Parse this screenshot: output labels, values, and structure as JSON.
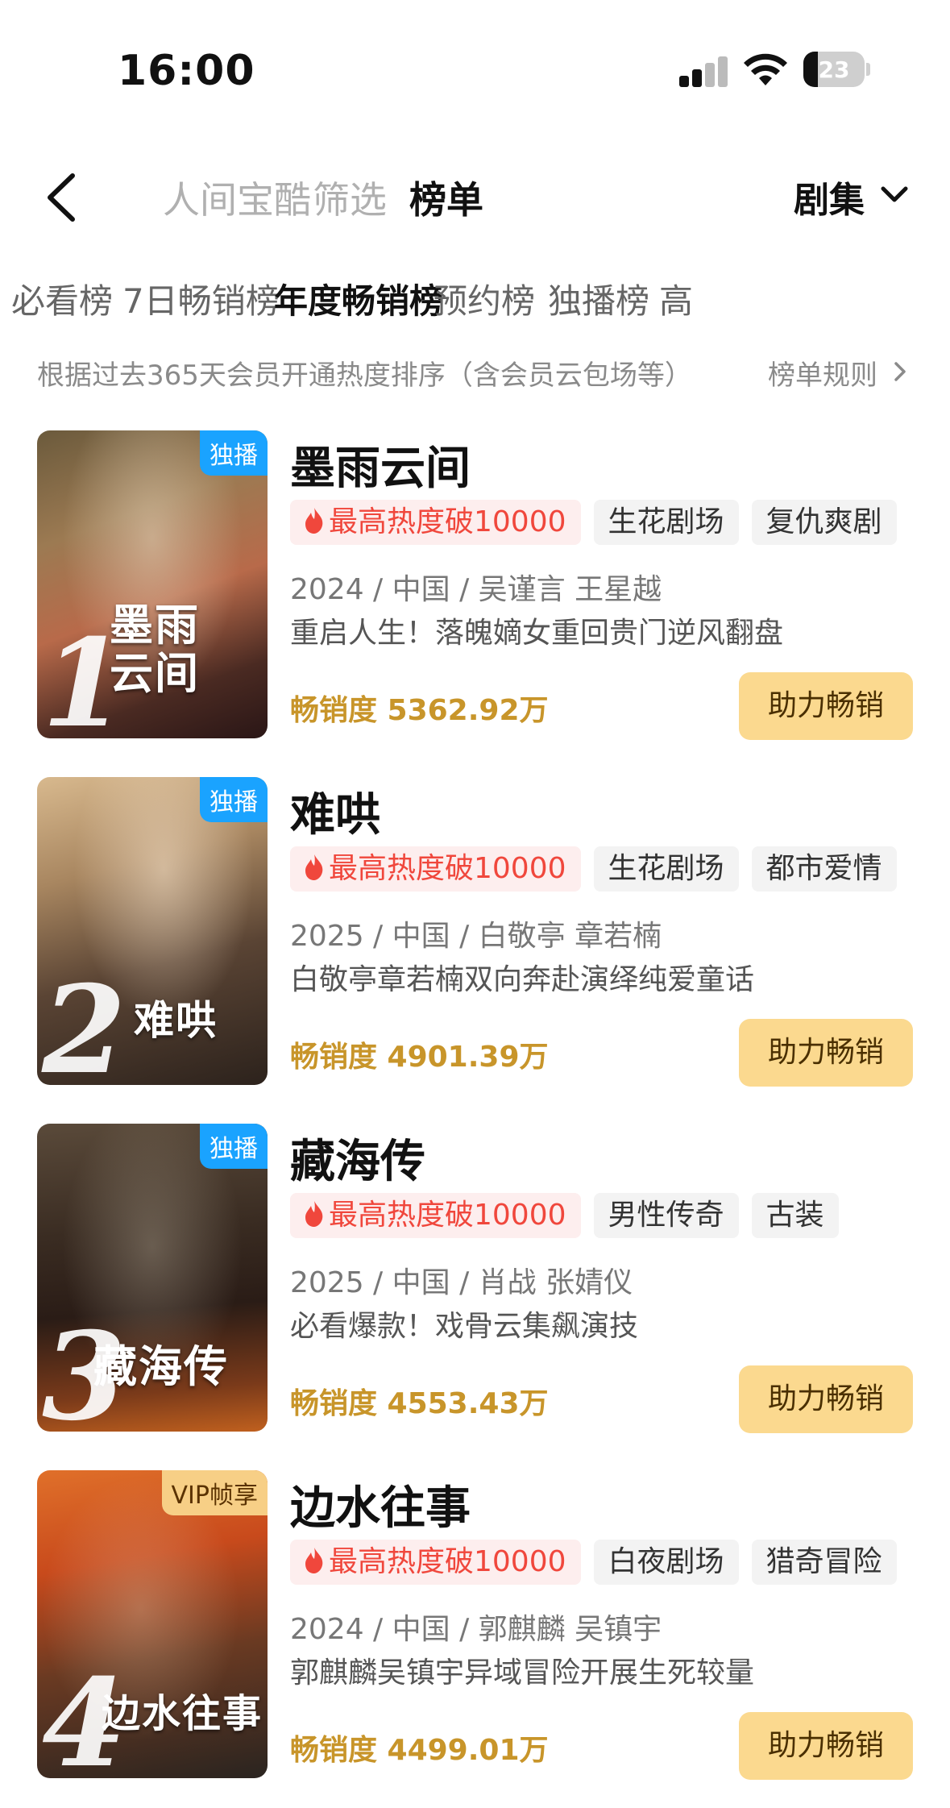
{
  "status_bar": {
    "time": "16:00",
    "battery": "23"
  },
  "nav": {
    "tabs": [
      {
        "label": "人间宝酷",
        "active": false
      },
      {
        "label": "筛选",
        "active": false
      },
      {
        "label": "榜单",
        "active": true
      }
    ],
    "category": "剧集"
  },
  "rank_tabs": [
    {
      "label": "必看榜",
      "active": false
    },
    {
      "label": "7日畅销榜",
      "active": false
    },
    {
      "label": "年度畅销榜",
      "active": true
    },
    {
      "label": "预约榜",
      "active": false
    },
    {
      "label": "独播榜",
      "active": false
    },
    {
      "label": "高",
      "active": false
    }
  ],
  "description": "根据过去365天会员开通热度排序（含会员云包场等）",
  "rules_label": "榜单规则",
  "boost_label": "助力畅销",
  "items": [
    {
      "rank": "1",
      "badge": "独播",
      "badge_type": "exclusive",
      "title": "墨雨云间",
      "poster_title": "墨雨 云间",
      "hot": "最高热度破10000",
      "tags": [
        "生花剧场",
        "复仇爽剧"
      ],
      "meta": "2024 / 中国 / 吴谨言 王星越",
      "tagline": "重启人生！落魄嫡女重回贵门逆风翻盘",
      "sales": "畅销度 5362.92万"
    },
    {
      "rank": "2",
      "badge": "独播",
      "badge_type": "exclusive",
      "title": "难哄",
      "poster_title": "难哄",
      "hot": "最高热度破10000",
      "tags": [
        "生花剧场",
        "都市爱情"
      ],
      "meta": "2025 / 中国 / 白敬亭 章若楠",
      "tagline": "白敬亭章若楠双向奔赴演绎纯爱童话",
      "sales": "畅销度 4901.39万"
    },
    {
      "rank": "3",
      "badge": "独播",
      "badge_type": "exclusive",
      "title": "藏海传",
      "poster_title": "藏海传",
      "hot": "最高热度破10000",
      "tags": [
        "男性传奇",
        "古装"
      ],
      "meta": "2025 / 中国 / 肖战 张婧仪",
      "tagline": "必看爆款！戏骨云集飙演技",
      "sales": "畅销度 4553.43万"
    },
    {
      "rank": "4",
      "badge": "VIP帧享",
      "badge_type": "vip",
      "title": "边水往事",
      "poster_title": "边水往事",
      "hot": "最高热度破10000",
      "tags": [
        "白夜剧场",
        "猎奇冒险"
      ],
      "meta": "2024 / 中国 / 郭麒麟 吴镇宇",
      "tagline": "郭麒麟吴镇宇异域冒险开展生死较量",
      "sales": "畅销度 4499.01万"
    }
  ],
  "colors": {
    "accent_gold": "#c8952a",
    "boost_bg": "#fbd98f",
    "hot_red": "#f0473c",
    "badge_blue": "#1aa3ff"
  }
}
